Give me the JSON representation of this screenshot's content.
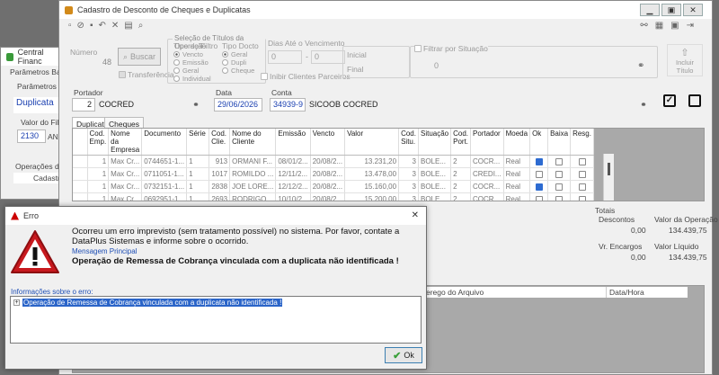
{
  "bg_window": {
    "title": "Central Financ",
    "params_basicos": "Parâmetros Básico",
    "params_f": "Parâmetros de F",
    "duplicata": "Duplicata",
    "valor_do_filtro_label": "Valor do Filtro",
    "valor_do_filtro": "2130",
    "an": "AN",
    "operacoes": "Operações dispo",
    "cadastro": "Cadastro"
  },
  "main_window": {
    "title": "Cadastro de Desconto de Cheques e Duplicatas",
    "numero_label": "Número",
    "numero": "48",
    "buscar": "Buscar",
    "transferencia": "Transferência",
    "selecao_title": "Seleção de Títulos da Operação",
    "tipo_filtro_label": "Tipo de Filtro",
    "tipo_filtro_options": [
      "Vencto",
      "Emissão",
      "Geral",
      "Individual"
    ],
    "tipo_docto_label": "Tipo Docto",
    "tipo_docto_options": [
      "Geral",
      "Dupli",
      "Cheque"
    ],
    "dias_label": "Dias Até o Vencimento",
    "dias_from": "0",
    "dias_sep": "-",
    "dias_to": "0",
    "inibir_label": "Inibir Clientes Parceiros",
    "inicial_label": "Inicial",
    "final_label": "Final",
    "filtrar_label": "Filtrar por Situação",
    "filtrar_value": "0",
    "incluir_line1": "Incluir",
    "incluir_line2": "Título",
    "portador_label": "Portador",
    "portador_num": "2",
    "portador_name": "COCRED",
    "data_label": "Data",
    "data_value": "29/06/2026",
    "conta_label": "Conta",
    "conta_num": "34939-9",
    "conta_name": "SICOOB COCRED",
    "tabs": [
      "Duplicatas",
      "Cheques"
    ],
    "columns": [
      "Cod. Emp.",
      "Nome da Empresa",
      "Documento",
      "Série",
      "Cod. Clie.",
      "Nome do Cliente",
      "Emissão",
      "Vencto",
      "Valor",
      "Cod. Situ.",
      "Situação",
      "Cod. Port.",
      "Portador",
      "Moeda",
      "Ok",
      "Baixa",
      "Resg."
    ],
    "rows": [
      [
        "1",
        "Max Cr...",
        "0744651-1...",
        "1",
        "913",
        "ORMANI F...",
        "08/01/2...",
        "20/08/2...",
        "13.231,20",
        "3",
        "BOLE...",
        "2",
        "COCR...",
        "Real",
        true,
        false,
        false
      ],
      [
        "1",
        "Max Cr...",
        "0711051-1...",
        "1",
        "1017",
        "ROMILDO ...",
        "12/11/2...",
        "20/08/2...",
        "13.478,00",
        "3",
        "BOLE...",
        "2",
        "CREDI...",
        "Real",
        false,
        false,
        false
      ],
      [
        "1",
        "Max Cr...",
        "0732151-1...",
        "1",
        "2838",
        "JOE LORE...",
        "12/12/2...",
        "20/08/2...",
        "15.160,00",
        "3",
        "BOLE...",
        "2",
        "COCR...",
        "Real",
        true,
        false,
        false
      ],
      [
        "1",
        "Max Cr...",
        "0692951-1...",
        "1",
        "2693",
        "RODRIGO...",
        "10/10/2...",
        "20/08/2...",
        "15.200,00",
        "3",
        "BOLE...",
        "2",
        "COCR...",
        "Real",
        false,
        false,
        false
      ]
    ],
    "totais_label": "Totais",
    "descontos_label": "Descontos",
    "descontos_value": "0,00",
    "valor_operacao_label": "Valor da Operação",
    "valor_operacao_value": "134.439,75",
    "vr_encargos_label": "Vr. Encargos",
    "vr_encargos_value": "0,00",
    "valor_liquido_label": "Valor Líquido",
    "valor_liquido_value": "134.439,75",
    "lower_col1": "erego do Arquivo",
    "lower_col2": "Data/Hora"
  },
  "error_dialog": {
    "title": "Erro",
    "message": "Ocorreu um erro imprevisto (sem tratamento possível) no sistema. Por favor, contate a DataPlus Sistemas e informe sobre o ocorrido.",
    "principal_label": "Mensagem Principal",
    "principal_message": "Operação de Remessa de Cobrança vinculada com a duplicata não identificada !",
    "info_label": "Informações sobre o erro:",
    "tree_item": "Operação de Remessa de Cobrança vinculada com a duplicata não identificada !",
    "ok_label": "Ok",
    "close_glyph": "✕"
  }
}
